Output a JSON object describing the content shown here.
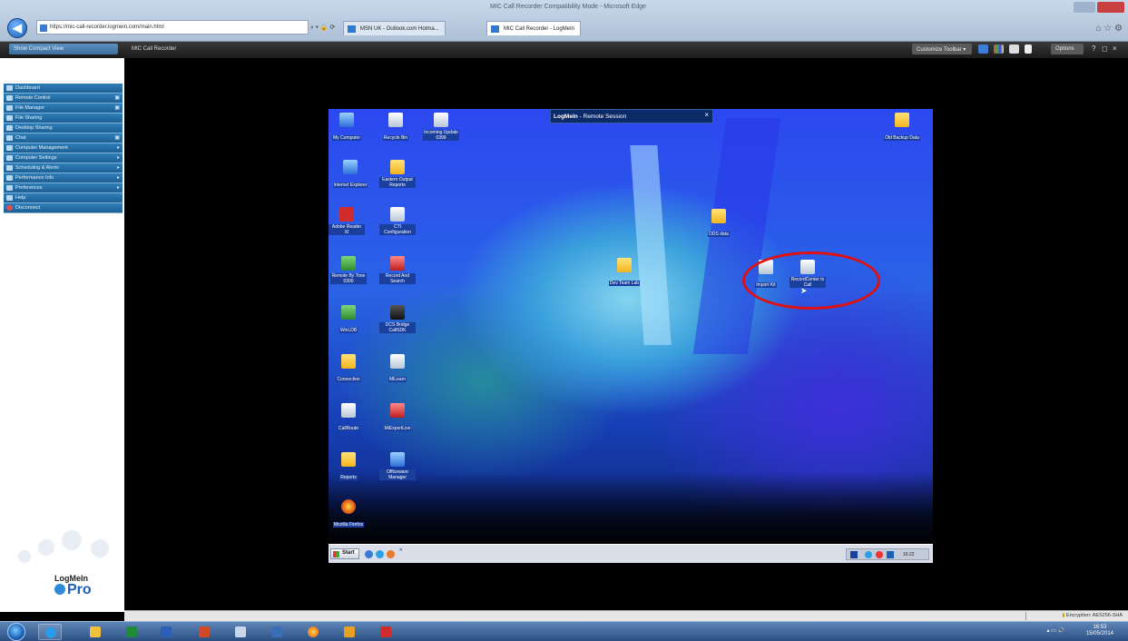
{
  "browser": {
    "window_title": "MIC Call Recorder Compatibility Mode - Microsoft Edge",
    "address": "https://mic-call-recorder.logmein.com/main.html",
    "tabs": [
      {
        "label": "MSN UK - Outlook.com Hotma..."
      },
      {
        "label": "MIC Call Recorder - LogMeIn"
      }
    ]
  },
  "app": {
    "compact_view": "Show Compact View",
    "session_title": "MIC Call Recorder",
    "customize_toolbar": "Customize Toolbar",
    "options": "Options"
  },
  "sidebar": {
    "items": [
      {
        "label": "Dashboard",
        "chevron": ""
      },
      {
        "label": "Remote Control",
        "chevron": "▣"
      },
      {
        "label": "File Manager",
        "chevron": "▣"
      },
      {
        "label": "File Sharing",
        "chevron": ""
      },
      {
        "label": "Desktop Sharing",
        "chevron": ""
      },
      {
        "label": "Chat",
        "chevron": "▣"
      },
      {
        "label": "Computer Management",
        "chevron": "▸"
      },
      {
        "label": "Computer Settings",
        "chevron": "▸"
      },
      {
        "label": "Scheduling & Alerts",
        "chevron": "▸"
      },
      {
        "label": "Performance Info",
        "chevron": "▸"
      },
      {
        "label": "Preferences",
        "chevron": "▸"
      },
      {
        "label": "Help",
        "chevron": ""
      },
      {
        "label": "Disconnect",
        "chevron": ""
      }
    ],
    "brand": "LogMeIn",
    "brand_pro": "Pro"
  },
  "remote": {
    "banner_brand": "LogMeIn",
    "banner_text": "Remote Session",
    "desktop_icons": [
      {
        "label": "My Computer",
        "kind": "blue"
      },
      {
        "label": "Recycle Bin",
        "kind": "white"
      },
      {
        "label": "Incoming Update 0399",
        "kind": "white"
      },
      {
        "label": "Internet Explorer",
        "kind": "blue"
      },
      {
        "label": "Eastern Output Reports",
        "kind": "folder"
      },
      {
        "label": "Adobe Reader XI",
        "kind": "pdf"
      },
      {
        "label": "CTI Configuration",
        "kind": "white"
      },
      {
        "label": "Remote By Tone 0300",
        "kind": "green"
      },
      {
        "label": "Record And Search",
        "kind": "red"
      },
      {
        "label": "WinLDB",
        "kind": "green"
      },
      {
        "label": "DCS Bridge CallSDK",
        "kind": "dark"
      },
      {
        "label": "Connection",
        "kind": "folder"
      },
      {
        "label": "MiLearn",
        "kind": "white"
      },
      {
        "label": "CallRoute",
        "kind": "white"
      },
      {
        "label": "MiExpertLive",
        "kind": "red"
      },
      {
        "label": "Reports",
        "kind": "folder"
      },
      {
        "label": "Officeware Manager",
        "kind": "blue"
      },
      {
        "label": "Mozilla Firefox",
        "kind": "fire"
      },
      {
        "label": "Old Backup Data",
        "kind": "folder"
      },
      {
        "label": "DDS data",
        "kind": "folder"
      },
      {
        "label": "Dev Team Lab",
        "kind": "folder"
      },
      {
        "label": "Import Kit",
        "kind": "white"
      },
      {
        "label": "RecordCenter to Call",
        "kind": "white"
      }
    ],
    "taskbar": {
      "start": "Start",
      "clock": "16:22"
    }
  },
  "status": {
    "encryption": "Encryption: AES256-SHA"
  },
  "win_taskbar": {
    "time": "16:53",
    "date": "15/05/2014"
  },
  "colors": {
    "nav_blue": "#2f7fb8",
    "highlight": "#e01010"
  }
}
